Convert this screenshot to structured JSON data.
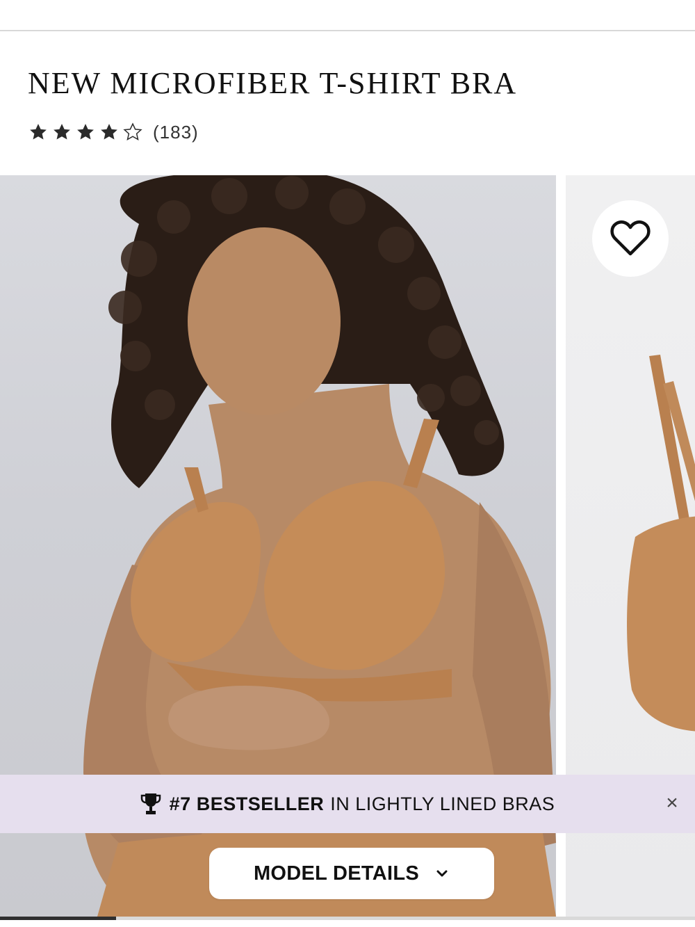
{
  "product": {
    "title": "NEW MICROFIBER T-SHIRT BRA",
    "rating": {
      "value": 4,
      "max": 5,
      "count_label": "(183)"
    }
  },
  "gallery": {
    "images": [
      {
        "name": "model-photo",
        "description_icon": "product-photo"
      },
      {
        "name": "product-flat-photo",
        "description_icon": "product-photo"
      }
    ],
    "current_index": 1,
    "total": 6,
    "progress_fraction": 0.167,
    "wishlist_icon": "heart-outline-icon"
  },
  "banner": {
    "icon": "trophy-icon",
    "strong": "#7 BESTSELLER",
    "rest": "IN LIGHTLY LINED BRAS",
    "close_glyph": "×",
    "background": "#e6dfee"
  },
  "model_details": {
    "label": "MODEL DETAILS",
    "icon": "chevron-down-icon"
  },
  "colors": {
    "text": "#111111",
    "skin": "#b98a64",
    "bra": "#c0895a",
    "hair": "#2a1d16"
  }
}
